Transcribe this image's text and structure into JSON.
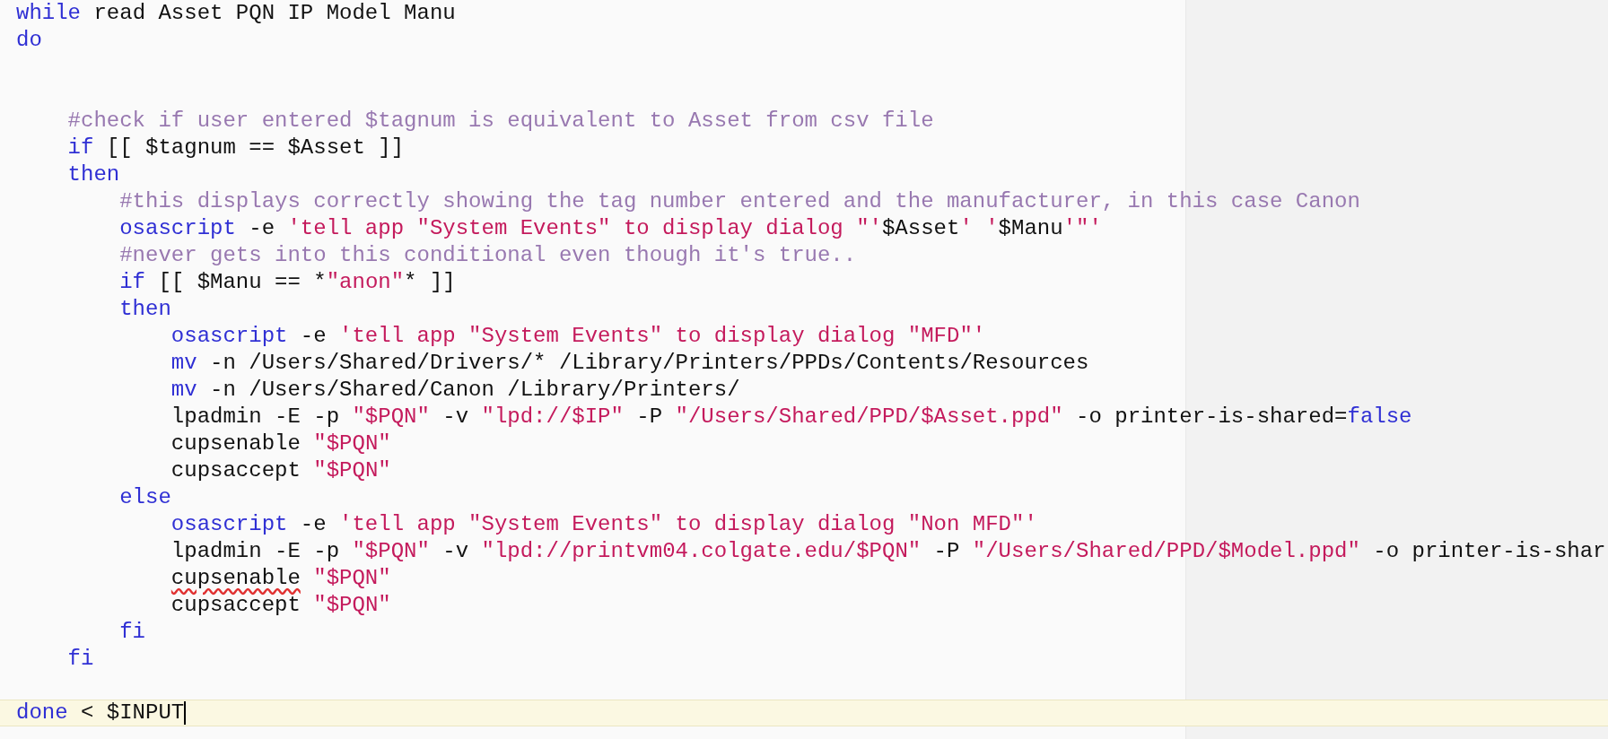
{
  "editor": {
    "lines": [
      {
        "current": false,
        "tokens": [
          {
            "kind": "keyword",
            "text": "while"
          },
          {
            "kind": "plain",
            "text": " read Asset PQN IP Model Manu"
          }
        ]
      },
      {
        "current": false,
        "tokens": [
          {
            "kind": "keyword",
            "text": "do"
          }
        ]
      },
      {
        "current": false
      },
      {
        "current": false
      },
      {
        "current": false,
        "tokens": [
          {
            "kind": "comment",
            "text": "    #check if user entered $tagnum is equivalent to Asset from csv file"
          }
        ]
      },
      {
        "current": false,
        "tokens": [
          {
            "kind": "keyword",
            "text": "    if"
          },
          {
            "kind": "plain",
            "text": " [[ $tagnum == $Asset ]]"
          }
        ]
      },
      {
        "current": false,
        "tokens": [
          {
            "kind": "keyword",
            "text": "    then"
          }
        ]
      },
      {
        "current": false,
        "tokens": [
          {
            "kind": "comment",
            "text": "        #this displays correctly showing the tag number entered and the manufacturer, in this case Canon"
          }
        ]
      },
      {
        "current": false,
        "tokens": [
          {
            "kind": "keyword",
            "text": "        osascript"
          },
          {
            "kind": "plain",
            "text": " -e "
          },
          {
            "kind": "string",
            "text": "'tell app \"System Events\" to display dialog \"'"
          },
          {
            "kind": "plain",
            "text": "$Asset"
          },
          {
            "kind": "string",
            "text": "' '"
          },
          {
            "kind": "plain",
            "text": "$Manu"
          },
          {
            "kind": "string",
            "text": "'\"'"
          }
        ]
      },
      {
        "current": false,
        "tokens": [
          {
            "kind": "comment",
            "text": "        #never gets into this conditional even though it's true.."
          }
        ]
      },
      {
        "current": false,
        "tokens": [
          {
            "kind": "keyword",
            "text": "        if"
          },
          {
            "kind": "plain",
            "text": " [[ $Manu == *"
          },
          {
            "kind": "string",
            "text": "\"anon\""
          },
          {
            "kind": "plain",
            "text": "* ]]"
          }
        ]
      },
      {
        "current": false,
        "tokens": [
          {
            "kind": "keyword",
            "text": "        then"
          }
        ]
      },
      {
        "current": false,
        "tokens": [
          {
            "kind": "keyword",
            "text": "            osascript"
          },
          {
            "kind": "plain",
            "text": " -e "
          },
          {
            "kind": "string",
            "text": "'tell app \"System Events\" to display dialog \"MFD\"'"
          }
        ]
      },
      {
        "current": false,
        "tokens": [
          {
            "kind": "keyword",
            "text": "            mv"
          },
          {
            "kind": "plain",
            "text": " -n /Users/Shared/Drivers/* /Library/Printers/PPDs/Contents/Resources"
          }
        ]
      },
      {
        "current": false,
        "tokens": [
          {
            "kind": "keyword",
            "text": "            mv"
          },
          {
            "kind": "plain",
            "text": " -n /Users/Shared/Canon /Library/Printers/"
          }
        ]
      },
      {
        "current": false,
        "tokens": [
          {
            "kind": "plain",
            "text": "            lpadmin -E -p "
          },
          {
            "kind": "string",
            "text": "\"$PQN\""
          },
          {
            "kind": "plain",
            "text": " -v "
          },
          {
            "kind": "string",
            "text": "\"lpd://$IP\""
          },
          {
            "kind": "plain",
            "text": " -P "
          },
          {
            "kind": "string",
            "text": "\"/Users/Shared/PPD/$Asset.ppd\""
          },
          {
            "kind": "plain",
            "text": " -o printer-is-shared="
          },
          {
            "kind": "keyword",
            "text": "false"
          }
        ]
      },
      {
        "current": false,
        "tokens": [
          {
            "kind": "plain",
            "text": "            cupsenable "
          },
          {
            "kind": "string",
            "text": "\"$PQN\""
          }
        ]
      },
      {
        "current": false,
        "tokens": [
          {
            "kind": "plain",
            "text": "            cupsaccept "
          },
          {
            "kind": "string",
            "text": "\"$PQN\""
          }
        ]
      },
      {
        "current": false,
        "tokens": [
          {
            "kind": "keyword",
            "text": "        else"
          }
        ]
      },
      {
        "current": false,
        "tokens": [
          {
            "kind": "keyword",
            "text": "            osascript"
          },
          {
            "kind": "plain",
            "text": " -e "
          },
          {
            "kind": "string",
            "text": "'tell app \"System Events\" to display dialog \"Non MFD\"'"
          }
        ]
      },
      {
        "current": false,
        "tokens": [
          {
            "kind": "plain",
            "text": "            lpadmin -E -p "
          },
          {
            "kind": "string",
            "text": "\"$PQN\""
          },
          {
            "kind": "plain",
            "text": " -v "
          },
          {
            "kind": "string",
            "text": "\"lpd://printvm04.colgate.edu/$PQN\""
          },
          {
            "kind": "plain",
            "text": " -P "
          },
          {
            "kind": "string",
            "text": "\"/Users/Shared/PPD/$Model.ppd\""
          },
          {
            "kind": "plain",
            "text": " -o printer-is-shar"
          }
        ]
      },
      {
        "current": false,
        "tokens": [
          {
            "kind": "flagged",
            "text": "            cupsenable"
          },
          {
            "kind": "string",
            "text": " \"$PQN\""
          }
        ]
      },
      {
        "current": false,
        "tokens": [
          {
            "kind": "plain",
            "text": "            cupsaccept "
          },
          {
            "kind": "string",
            "text": "\"$PQN\""
          }
        ]
      },
      {
        "current": false,
        "tokens": [
          {
            "kind": "keyword",
            "text": "        fi"
          }
        ]
      },
      {
        "current": false,
        "tokens": [
          {
            "kind": "keyword",
            "text": "    fi"
          }
        ]
      },
      {
        "current": false
      },
      {
        "current": true,
        "tokens": [
          {
            "kind": "keyword",
            "text": "done"
          },
          {
            "kind": "plain",
            "text": " < $INPUT"
          }
        ]
      }
    ]
  }
}
